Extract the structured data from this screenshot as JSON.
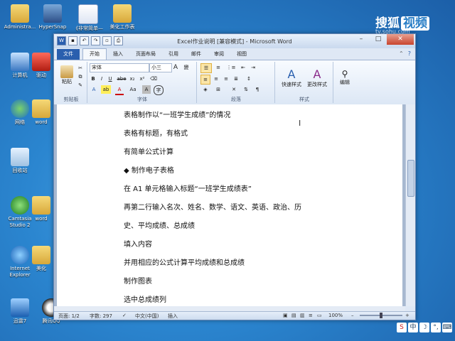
{
  "watermark": {
    "brand": "搜狐",
    "box": "视频",
    "url": "tv.sohu.com"
  },
  "desktop_icons": [
    {
      "label": "Administra...",
      "icon": "folder-icon"
    },
    {
      "label": "HyperSnap",
      "icon": "hypersnap-icon"
    },
    {
      "label": "《非常简单—",
      "icon": "word-doc-icon"
    },
    {
      "label": "美化工作表",
      "icon": "folder-icon"
    },
    {
      "label": "计算机",
      "icon": "computer-icon"
    },
    {
      "label": "驱动",
      "icon": "driver-icon"
    },
    {
      "label": "网络",
      "icon": "network-icon"
    },
    {
      "label": "word",
      "icon": "folder-icon"
    },
    {
      "label": "回收站",
      "icon": "recycle-bin-icon"
    },
    {
      "label": "Camtasia Studio 2",
      "icon": "camtasia-icon"
    },
    {
      "label": "word",
      "icon": "folder-icon"
    },
    {
      "label": "Internet Explorer",
      "icon": "ie-icon"
    },
    {
      "label": "美化",
      "icon": "folder-icon"
    },
    {
      "label": "迅雷7",
      "icon": "thunder-icon"
    },
    {
      "label": "腾讯QQ",
      "icon": "qq-icon"
    }
  ],
  "window": {
    "title": "Excel作业说明 [兼容模式] - Microsoft Word",
    "tabs": [
      "文件",
      "开始",
      "插入",
      "页面布局",
      "引用",
      "邮件",
      "审阅",
      "视图"
    ],
    "ribbon": {
      "clipboard": {
        "paste": "粘贴",
        "label": "剪贴板"
      },
      "font": {
        "name": "宋体",
        "size": "小三",
        "label": "字体",
        "wen": "變",
        "bold": "B",
        "italic": "I",
        "underline": "U",
        "strike": "abe",
        "sub": "x₂",
        "sup": "x²",
        "fontcolor": "A",
        "aa": "Aa",
        "bigA": "A"
      },
      "paragraph": {
        "label": "段落"
      },
      "styles": {
        "quick": "快速样式",
        "change": "更改样式",
        "label": "样式"
      },
      "editing": {
        "label": "编辑"
      }
    },
    "document": {
      "paragraphs": [
        "表格制作以“一班学生成绩”的情况",
        "表格有标题，有格式",
        "有简单公式计算",
        "◆ 制作电子表格",
        "在 A1 单元格输入标题“一班学生成绩表”",
        "再第二行输入名次、姓名、数学、语文、英语、政治、历",
        "史、平均成绩、总成绩",
        "填入内容",
        "并用相应的公式计算平均成绩和总成绩",
        "制作图表",
        "选中总成绩列"
      ]
    },
    "status": {
      "page": "页面: 1/2",
      "words": "字数: 297",
      "lang": "中文(中国)",
      "mode": "插入",
      "zoom": "100%"
    }
  }
}
